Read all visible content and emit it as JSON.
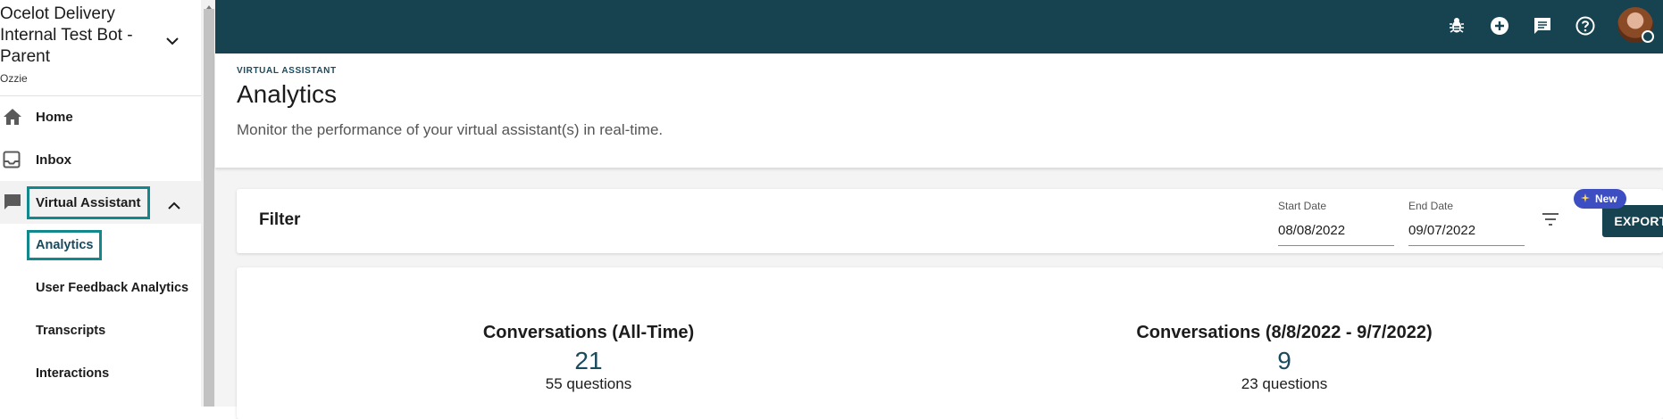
{
  "org": {
    "title": "Ocelot Delivery Internal Test Bot - Parent",
    "subtitle": "Ozzie"
  },
  "nav": {
    "home": "Home",
    "inbox": "Inbox",
    "virtual_assistant": "Virtual Assistant",
    "sub_items": [
      "Analytics",
      "User Feedback Analytics",
      "Transcripts",
      "Interactions"
    ]
  },
  "topbar": {
    "icons": [
      "bug-icon",
      "add-circle-icon",
      "chat-icon",
      "help-icon"
    ]
  },
  "header": {
    "eyebrow": "VIRTUAL ASSISTANT",
    "title": "Analytics",
    "subtitle": "Monitor the performance of your virtual assistant(s) in real-time."
  },
  "filter": {
    "title": "Filter",
    "start_label": "Start Date",
    "start_value": "08/08/2022",
    "end_label": "End Date",
    "end_value": "09/07/2022",
    "export_label": "EXPORT",
    "new_badge": "New"
  },
  "stats": {
    "all_time_title": "Conversations (All-Time)",
    "all_time_value": "21",
    "all_time_sub": "55 questions",
    "range_title": "Conversations (8/8/2022 - 9/7/2022)",
    "range_value": "9",
    "range_sub": "23 questions"
  },
  "colors": {
    "brand": "#174350",
    "highlight": "#13888c",
    "badge": "#3d4ec2"
  }
}
